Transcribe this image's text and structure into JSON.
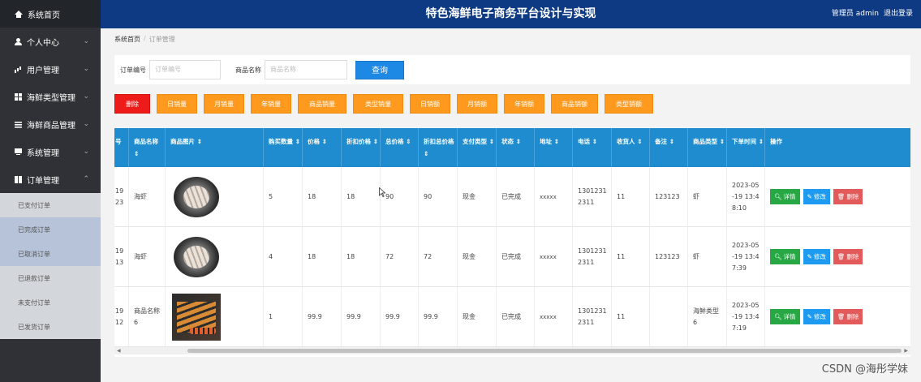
{
  "header": {
    "title": "特色海鲜电子商务平台设计与实现",
    "user_label": "管理员 admin",
    "logout": "退出登录"
  },
  "sidebar": {
    "home": "系统首页",
    "items": [
      {
        "label": "个人中心",
        "icon": "user-icon"
      },
      {
        "label": "用户管理",
        "icon": "bar-chart-icon"
      },
      {
        "label": "海鲜类型管理",
        "icon": "grid-icon"
      },
      {
        "label": "海鲜商品管理",
        "icon": "list-icon"
      },
      {
        "label": "系统管理",
        "icon": "monitor-icon"
      },
      {
        "label": "订单管理",
        "icon": "book-icon"
      }
    ],
    "sub": [
      "已支付订单",
      "已完成订单",
      "已取消订单",
      "已退款订单",
      "未支付订单",
      "已发货订单"
    ]
  },
  "breadcrumb": {
    "home": "系统首页",
    "sep": "/",
    "current": "订单管理"
  },
  "search": {
    "order_label": "订单编号",
    "order_placeholder": "订单编号",
    "name_label": "商品名称",
    "name_placeholder": "商品名称",
    "query": "查询"
  },
  "actions": [
    "删除",
    "日销量",
    "月销量",
    "年销量",
    "商品销量",
    "类型销量",
    "日销额",
    "月销额",
    "年销额",
    "商品销额",
    "类型销额"
  ],
  "table": {
    "headers": [
      "号",
      "商品名称 ⇕",
      "商品图片 ⇕",
      "购买数量 ⇕",
      "价格 ⇕",
      "折扣价格 ⇕",
      "总价格 ⇕",
      "折扣总价格 ⇕",
      "支付类型 ⇕",
      "状态 ⇕",
      "地址 ⇕",
      "电话 ⇕",
      "收货人 ⇕",
      "备注 ⇕",
      "商品类型 ⇕",
      "下单时间 ⇕",
      "操作"
    ],
    "rows": [
      {
        "no": "19\n23",
        "name": "海虾",
        "image": "shrimp",
        "qty": "5",
        "price": "18",
        "disc_price": "18",
        "total": "90",
        "disc_total": "90",
        "pay": "现金",
        "status": "已完成",
        "addr": "xxxxx",
        "phone": "1301231\n2311",
        "receiver": "11",
        "note": "123123",
        "type": "虾",
        "time": "2023-05\n-19 13:4\n8:10"
      },
      {
        "no": "19\n13",
        "name": "海虾",
        "image": "shrimp",
        "qty": "4",
        "price": "18",
        "disc_price": "18",
        "total": "72",
        "disc_total": "72",
        "pay": "现金",
        "status": "已完成",
        "addr": "xxxxx",
        "phone": "1301231\n2311",
        "receiver": "11",
        "note": "123123",
        "type": "虾",
        "time": "2023-05\n-19 13:4\n7:39"
      },
      {
        "no": "19\n12",
        "name": "商品名称\n6",
        "image": "skewer",
        "qty": "1",
        "price": "99.9",
        "disc_price": "99.9",
        "total": "99.9",
        "disc_total": "99.9",
        "pay": "现金",
        "status": "已完成",
        "addr": "xxxxx",
        "phone": "1301231\n2311",
        "receiver": "11",
        "note": "",
        "type": "海鲜类型\n6",
        "time": "2023-05\n-19 13:4\n7:19"
      }
    ],
    "ops": {
      "detail": "详情",
      "edit": "修改",
      "delete": "删除"
    }
  },
  "watermark": "CSDN @海彤学妹",
  "colors": {
    "header": "#0e3a83",
    "sidebar": "#2f3136",
    "table_head": "#1e8ccf",
    "orange": "#ff9a1f",
    "red": "#ee1b1b"
  }
}
